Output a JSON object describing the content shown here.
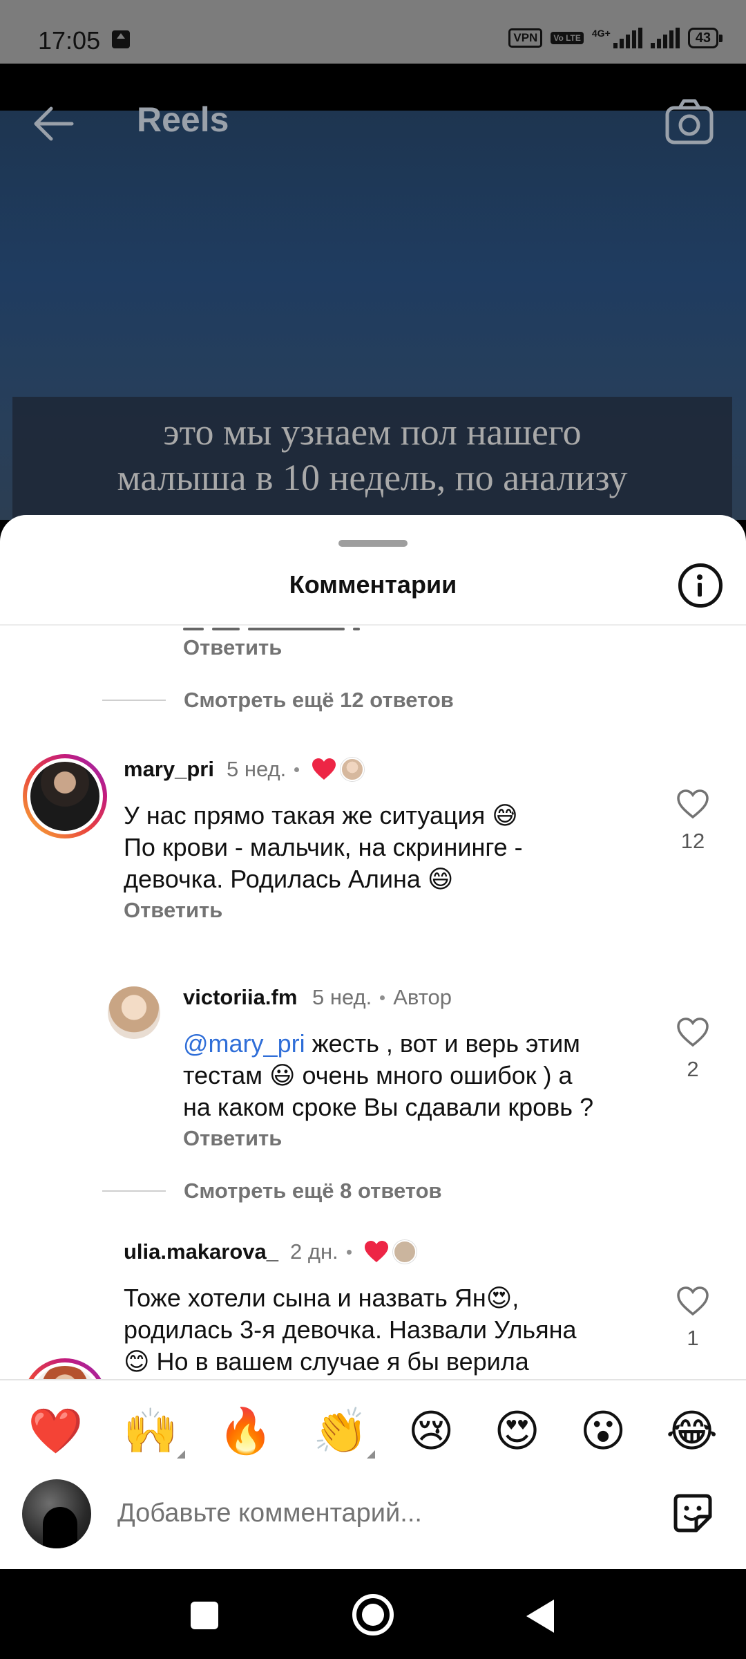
{
  "status_bar": {
    "time": "17:05",
    "vpn": "VPN",
    "volte": "Vo LTE",
    "network": "4G+",
    "battery": "43"
  },
  "reel": {
    "title": "Reels",
    "caption_line1": "это мы узнаем пол нашего",
    "caption_line2": "малыша в 10 недель, по анализу"
  },
  "sheet": {
    "title": "Комментарии"
  },
  "thread_top": {
    "reply_label": "Ответить",
    "more_replies": "Смотреть ещё 12 ответов"
  },
  "comments": [
    {
      "username": "mary_pri",
      "time": "5 нед.",
      "text_line1": "У нас прямо такая же ситуация 😅",
      "text_line2": "По крови - мальчик, на скрининге -",
      "text_line3": "девочка. Родилась Алина 😄",
      "reply_label": "Ответить",
      "likes": "12"
    },
    {
      "username": "victoriia.fm",
      "time": "5 нед.",
      "author_badge": "Автор",
      "mention": "@mary_pri",
      "text_line1_rest": " жесть , вот и верь этим",
      "text_line2": "тестам 😃 очень много ошибок ) а",
      "text_line3": "на каком сроке Вы сдавали кровь ?",
      "reply_label": "Ответить",
      "likes": "2",
      "more_replies": "Смотреть ещё 8 ответов"
    },
    {
      "username": "ulia.makarova_",
      "time": "2 дн.",
      "text_line1": "Тоже хотели сына и назвать Ян😍,",
      "text_line2": "родилась 3-я девочка. Назвали Ульяна",
      "text_line3": "😊 Но в вашем случае я бы верила",
      "likes": "1"
    }
  ],
  "emoji_bar": [
    "❤️",
    "🙌",
    "🔥",
    "👏",
    "😢",
    "😍",
    "😮",
    "😂"
  ],
  "input": {
    "placeholder": "Добавьте комментарий..."
  },
  "colors": {
    "accent_link": "#2f6ed8",
    "like_red": "#ed2545",
    "secondary_text": "#737373"
  }
}
